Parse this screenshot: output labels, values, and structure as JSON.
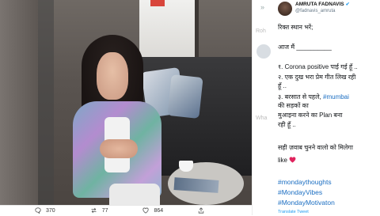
{
  "reactions": {
    "comments": "370",
    "retweets": "77",
    "likes": "864"
  },
  "icons": {
    "comment": "comment-icon",
    "retweet": "retweet-icon",
    "like": "heart-icon",
    "share": "share-icon"
  },
  "middle": {
    "skip_symbol": "»",
    "ghost_texts": [
      "Roh",
      "Wha"
    ]
  },
  "tweet": {
    "author_name": "AMRUTA FADNAVIS",
    "handle": "@fadnavis_amruta",
    "line1": "रिक्त स्थान भरें;",
    "line2": "आज मैं __________",
    "line3": "१. Corona positive पाई गई हूँ ..",
    "line4": "२. एक दुख भरा प्रेम गीत लिख रही",
    "line5": "हूँ ..",
    "line6_prefix": "३. बरसात से पहले, ",
    "line6_tag": "#mumbai",
    "line7": "की सड़कों का",
    "line8": "मुआइना करने का Plan बना",
    "line9": "रही हूँ ..",
    "line10": "सही ज़वाब चुनने वालो को मिलेगा",
    "line11": "like",
    "hashtags": [
      "#mondaythoughts",
      "#MondayVibes",
      "#MondayMotivaton"
    ],
    "translate": "Translate Tweet"
  },
  "colors": {
    "link": "#1b6ec2",
    "heart": "#e0245e",
    "verified": "#1d9bf0"
  }
}
